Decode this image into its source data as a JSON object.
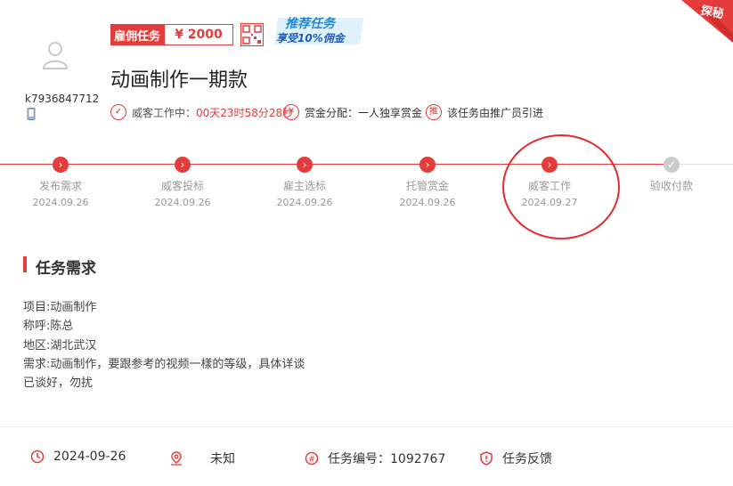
{
  "user": {
    "name": "k7936847712"
  },
  "task": {
    "type_tag": "雇佣任务",
    "price": "¥ 2000",
    "promo_line1": "推荐任务",
    "promo_line2": "享受10%佣金",
    "title": "动画制作一期款",
    "status_label": "威客工作中：",
    "countdown": "00天23时58分28秒",
    "reward_mode": "赏金分配：一人独享赏金",
    "referral": "该任务由推广员引进",
    "corner_badge": "探秘"
  },
  "timeline": [
    {
      "label": "发布需求",
      "date": "2024.09.26",
      "done": true
    },
    {
      "label": "威客投标",
      "date": "2024.09.26",
      "done": true
    },
    {
      "label": "雇主选标",
      "date": "2024.09.26",
      "done": true
    },
    {
      "label": "托管赏金",
      "date": "2024.09.26",
      "done": true
    },
    {
      "label": "威客工作",
      "date": "2024.09.27",
      "done": true
    },
    {
      "label": "验收付款",
      "date": "",
      "done": false
    }
  ],
  "requirements": {
    "heading": "任务需求",
    "lines": [
      "项目:动画制作",
      "称呼:陈总",
      "地区:湖北武汉",
      "需求:动画制作，要跟参考的视频一樣的等级，具体详谈",
      "已谈好，勿扰"
    ]
  },
  "footer": {
    "date": "2024-09-26",
    "location": "未知",
    "task_number": "任务编号：1092767",
    "feedback": "任务反馈"
  },
  "colors": {
    "accent": "#e43b3b",
    "muted": "#999999"
  }
}
